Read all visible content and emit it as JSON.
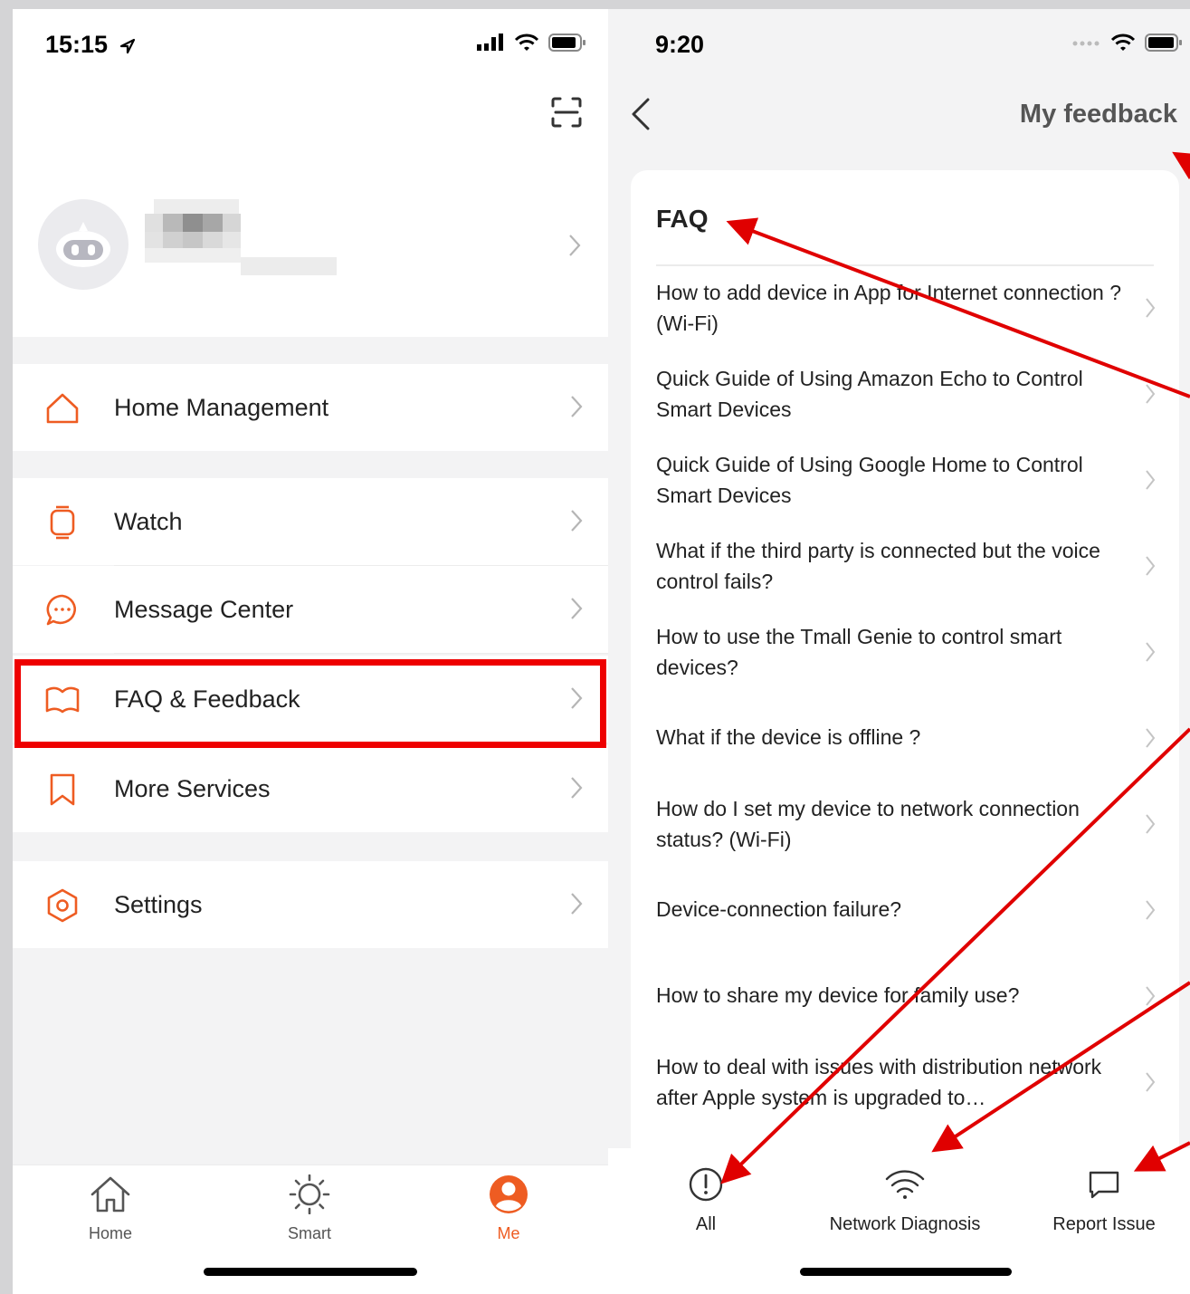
{
  "left": {
    "status_time": "15:15",
    "menu": [
      {
        "label": "Home Management",
        "icon": "home-icon"
      },
      {
        "label": "Watch",
        "icon": "watch-icon"
      },
      {
        "label": "Message Center",
        "icon": "message-icon"
      },
      {
        "label": "FAQ & Feedback",
        "icon": "book-icon",
        "highlighted": true
      },
      {
        "label": "More Services",
        "icon": "bookmark-icon"
      },
      {
        "label": "Settings",
        "icon": "settings-icon"
      }
    ],
    "tabs": [
      {
        "label": "Home",
        "icon": "home-icon"
      },
      {
        "label": "Smart",
        "icon": "sun-icon"
      },
      {
        "label": "Me",
        "icon": "user-icon",
        "active": true
      }
    ]
  },
  "right": {
    "status_time": "9:20",
    "nav_title": "My feedback",
    "faq_title": "FAQ",
    "questions": [
      "How to add device in App for Internet connection ? (Wi-Fi)",
      "Quick Guide of Using Amazon Echo to Control Smart Devices",
      "Quick Guide of Using Google Home to Control Smart Devices",
      "What if the third party is connected but the voice control fails?",
      "How to use the Tmall Genie to control smart devices?",
      "What if the device is offline ?",
      "How do I set my device to network connection status? (Wi-Fi)",
      "Device-connection failure?",
      "How to share my device for family use?",
      "How to deal with issues with distribution network after Apple system is upgraded to…"
    ],
    "tabs": [
      {
        "label": "All",
        "icon": "alert-circle-icon"
      },
      {
        "label": "Network Diagnosis",
        "icon": "wifi-icon"
      },
      {
        "label": "Report Issue",
        "icon": "chat-icon"
      }
    ]
  },
  "colors": {
    "accent": "#ee5c22",
    "highlight": "#ee0000",
    "arrow": "#e00000"
  }
}
